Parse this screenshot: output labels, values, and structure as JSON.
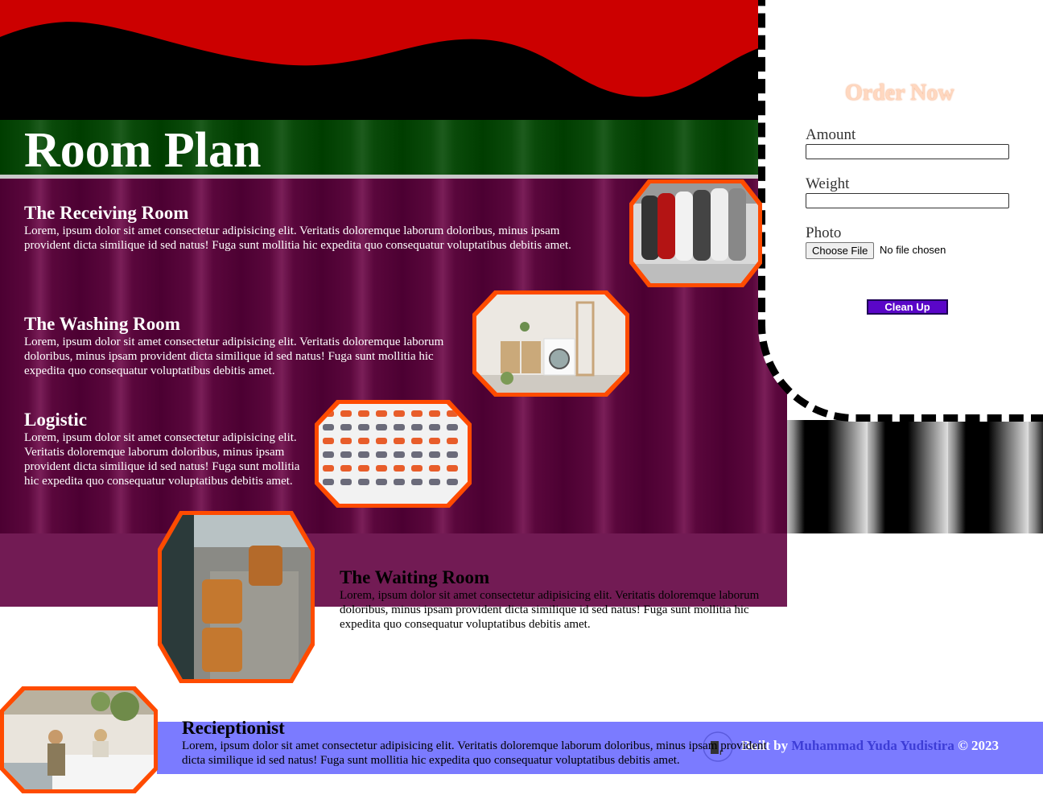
{
  "page_title": "Room Plan",
  "sections": [
    {
      "title": "The Receiving Room",
      "text": "Lorem, ipsum dolor sit amet consectetur adipisicing elit. Veritatis doloremque laborum doloribus, minus ipsam provident dicta similique id sed natus! Fuga sunt mollitia hic expedita quo consequatur voluptatibus debitis amet."
    },
    {
      "title": "The Washing Room",
      "text": "Lorem, ipsum dolor sit amet consectetur adipisicing elit. Veritatis doloremque laborum doloribus, minus ipsam provident dicta similique id sed natus! Fuga sunt mollitia hic expedita quo consequatur voluptatibus debitis amet."
    },
    {
      "title": "Logistic",
      "text": "Lorem, ipsum dolor sit amet consectetur adipisicing elit. Veritatis doloremque laborum doloribus, minus ipsam provident dicta similique id sed natus! Fuga sunt mollitia hic expedita quo consequatur voluptatibus debitis amet."
    },
    {
      "title": "The Waiting Room",
      "text": "Lorem, ipsum dolor sit amet consectetur adipisicing elit. Veritatis doloremque laborum doloribus, minus ipsam provident dicta similique id sed natus! Fuga sunt mollitia hic expedita quo consequatur voluptatibus debitis amet."
    },
    {
      "title": "Recieptionist",
      "text": "Lorem, ipsum dolor sit amet consectetur adipisicing elit. Veritatis doloremque laborum doloribus, minus ipsam provident dicta similique id sed natus! Fuga sunt mollitia hic expedita quo consequatur voluptatibus debitis amet."
    }
  ],
  "order_form": {
    "title": "Order Now",
    "amount_label": "Amount",
    "amount_value": "",
    "weight_label": "Weight",
    "weight_value": "",
    "photo_label": "Photo",
    "file_button": "Choose File",
    "file_status": "No file chosen",
    "submit_label": "Clean Up"
  },
  "footer": {
    "built_by": "Built by",
    "author": "Muhammad Yuda Yudistira",
    "copyright": "© 2023",
    "logo_icon": "laundry-logo-icon"
  },
  "images": {
    "receiving": "shoes-rack-photo",
    "washing": "washing-machine-photo",
    "logistic": "sneaker-grid-photo",
    "waiting": "armchairs-photo",
    "reception": "reception-desk-photo"
  },
  "colors": {
    "accent_orange": "#ff4b00",
    "title_green": "#003d00",
    "panel_purple": "#5a073c",
    "button_purple": "#5a06c8",
    "footer_blue": "#7b7bff",
    "hero_red": "#cc0000"
  }
}
